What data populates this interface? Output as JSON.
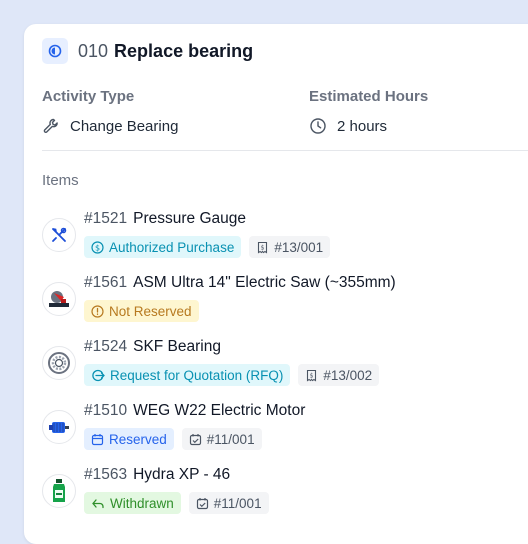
{
  "work_order": {
    "number": "010",
    "title": "Replace bearing",
    "status_icon": "half-circle-status-icon"
  },
  "fields": {
    "activity_type": {
      "label": "Activity Type",
      "value": "Change Bearing",
      "icon": "wrench-icon"
    },
    "estimated_hours": {
      "label": "Estimated Hours",
      "value": "2 hours",
      "icon": "clock-icon"
    }
  },
  "items_section": {
    "label": "Items",
    "items": [
      {
        "number": "#1521",
        "name": "Pressure Gauge",
        "thumb": "tools-icon",
        "status": {
          "label": "Authorized Purchase",
          "icon": "dollar-icon",
          "color": "#0891b2"
        },
        "ref": {
          "label": "#13/001",
          "icon": "receipt-icon"
        }
      },
      {
        "number": "#1561",
        "name": "ASM Ultra 14\" Electric Saw (~355mm)",
        "thumb": "saw-image",
        "status": {
          "label": "Not Reserved",
          "icon": "info-icon",
          "color": "#b7791f"
        }
      },
      {
        "number": "#1524",
        "name": "SKF Bearing",
        "thumb": "bearing-image",
        "status": {
          "label": "Request for Quotation (RFQ)",
          "icon": "rfq-icon",
          "color": "#0891b2"
        },
        "ref": {
          "label": "#13/002",
          "icon": "receipt-icon"
        }
      },
      {
        "number": "#1510",
        "name": "WEG W22 Electric Motor",
        "thumb": "motor-image",
        "status": {
          "label": "Reserved",
          "icon": "calendar-icon",
          "color": "#2563eb"
        },
        "ref": {
          "label": "#11/001",
          "icon": "calendar-check-icon"
        }
      },
      {
        "number": "#1563",
        "name": "Hydra XP - 46",
        "thumb": "oil-bottle-image",
        "status": {
          "label": "Withdrawn",
          "icon": "arrow-return-icon",
          "color": "#2f8f2a"
        },
        "ref": {
          "label": "#11/001",
          "icon": "calendar-check-icon"
        }
      }
    ]
  }
}
